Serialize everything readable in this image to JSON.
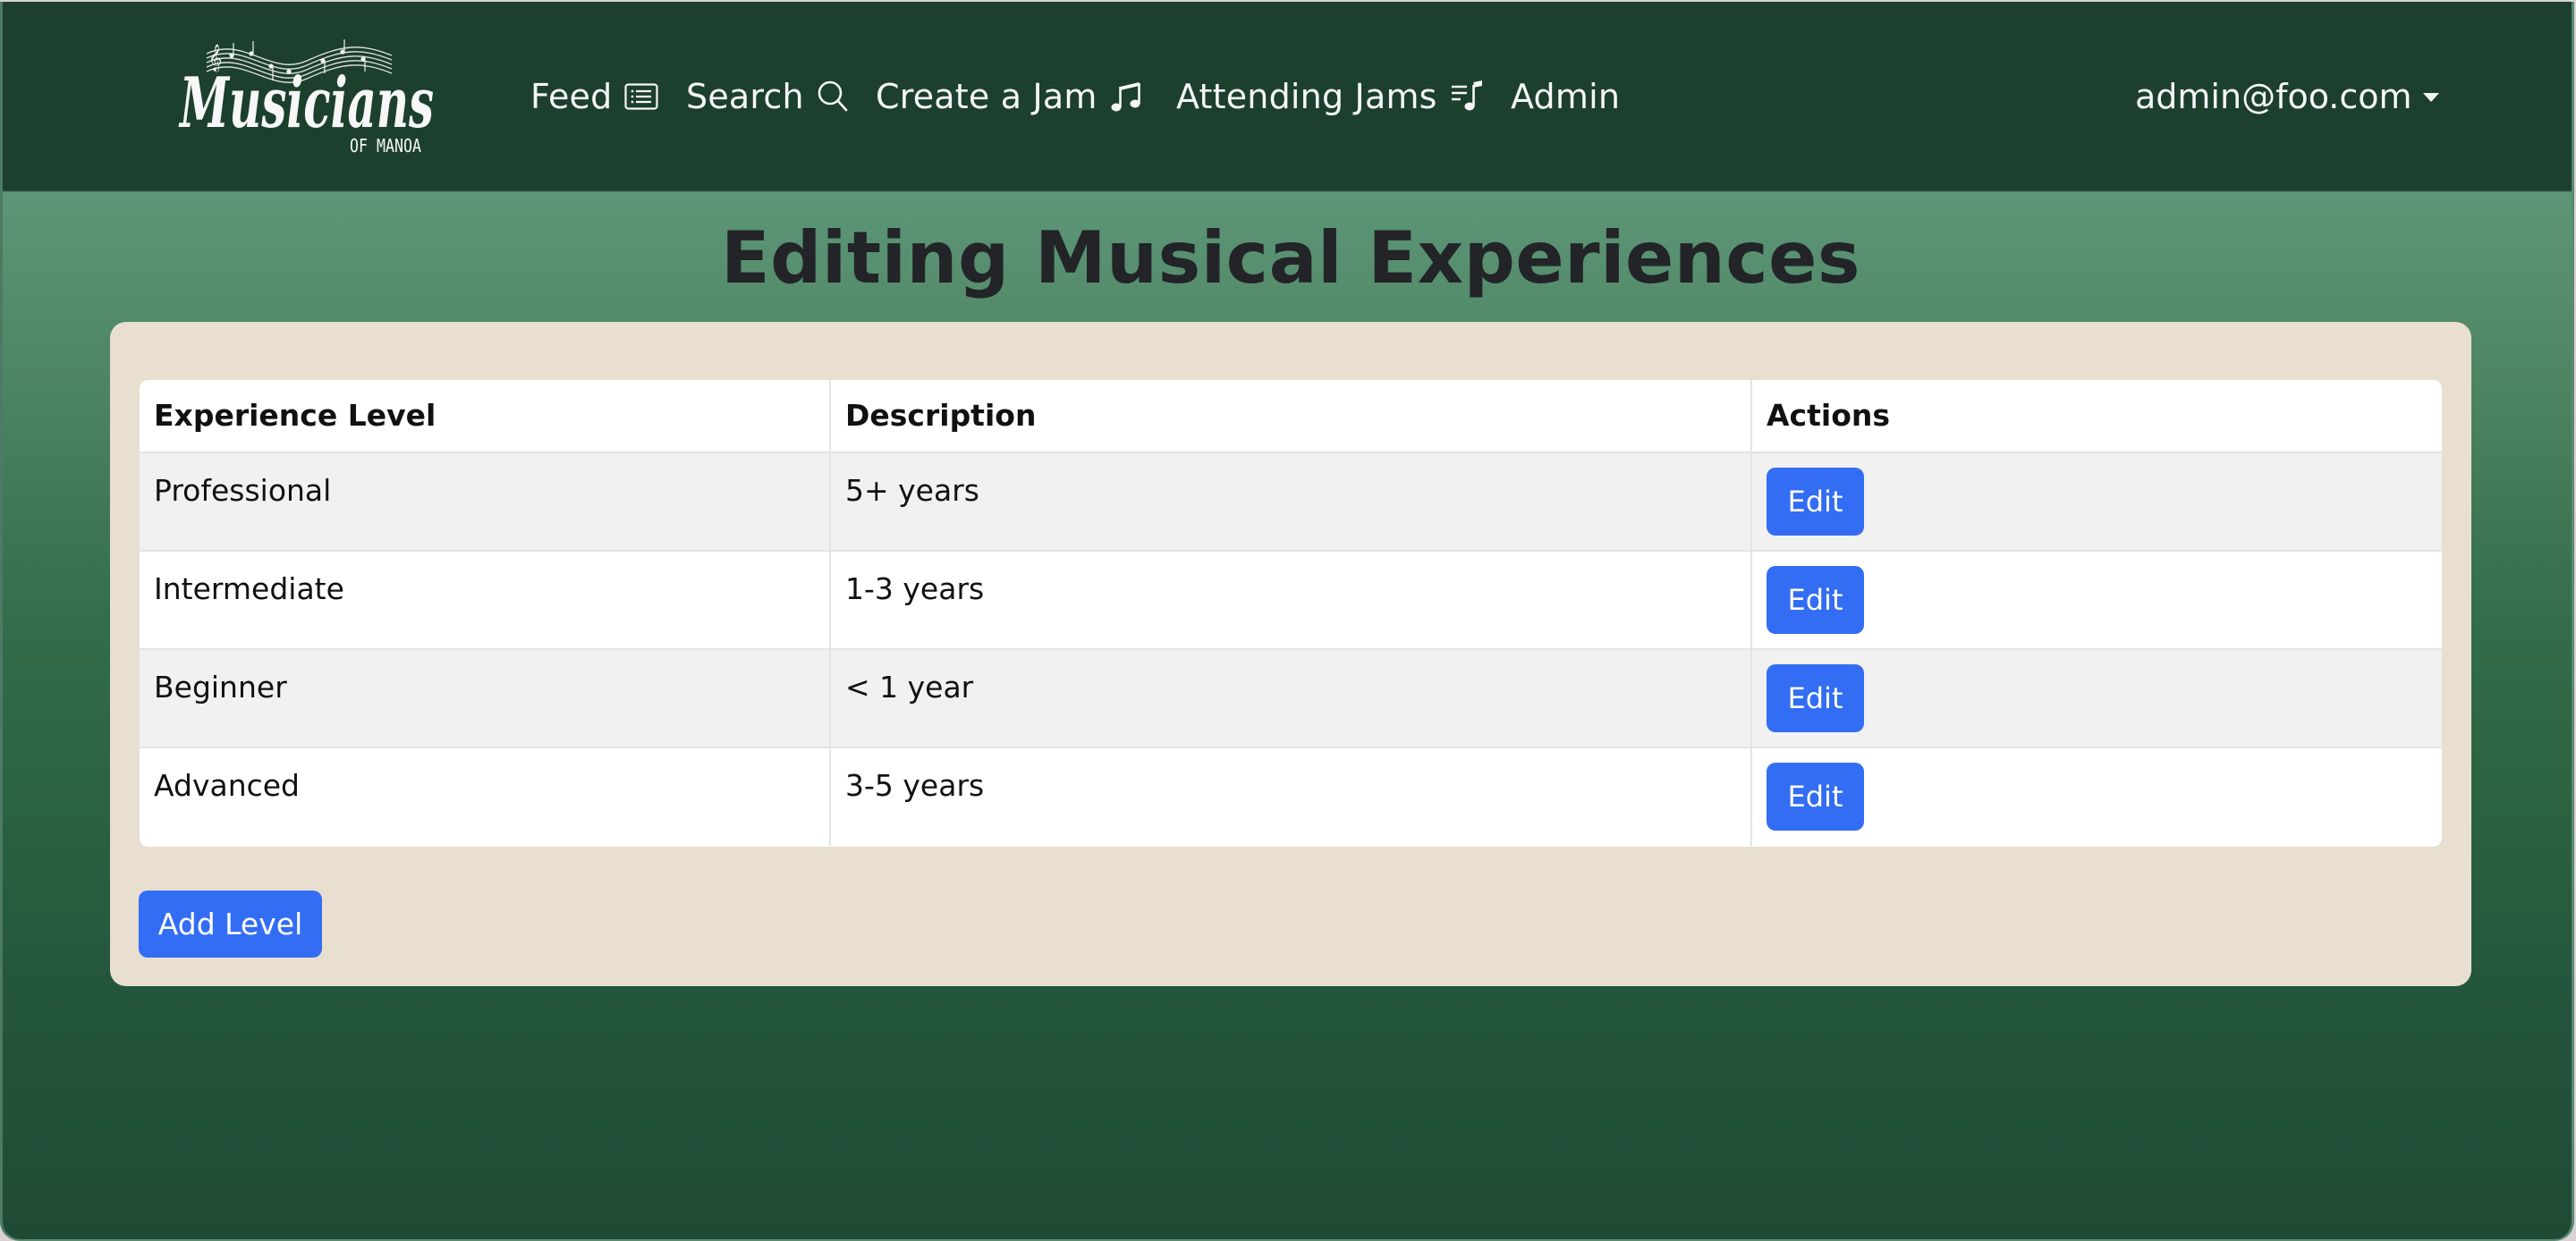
{
  "app": {
    "logo_text": "Musicians",
    "logo_subtext": "OF MANOA"
  },
  "nav": {
    "items": [
      {
        "label": "Feed",
        "icon": "card-list-icon"
      },
      {
        "label": "Search",
        "icon": "search-icon"
      },
      {
        "label": "Create a Jam",
        "icon": "music-note-beamed-icon"
      },
      {
        "label": "Attending Jams",
        "icon": "music-note-list-icon"
      },
      {
        "label": "Admin"
      }
    ],
    "user": {
      "label": "admin@foo.com",
      "icon": "caret-down-icon"
    }
  },
  "page": {
    "title": "Editing Musical Experiences"
  },
  "table": {
    "columns": [
      "Experience Level",
      "Description",
      "Actions"
    ],
    "rows": [
      {
        "level": "Professional",
        "description": "5+ years",
        "action": "Edit"
      },
      {
        "level": "Intermediate",
        "description": "1-3 years",
        "action": "Edit"
      },
      {
        "level": "Beginner",
        "description": "< 1 year",
        "action": "Edit"
      },
      {
        "level": "Advanced",
        "description": "3-5 years",
        "action": "Edit"
      }
    ]
  },
  "buttons": {
    "add_level": "Add Level"
  },
  "colors": {
    "navbar": "#1c3f2e",
    "card": "#e9dfd0",
    "primary_button": "#336df4",
    "title_text": "#222427"
  }
}
